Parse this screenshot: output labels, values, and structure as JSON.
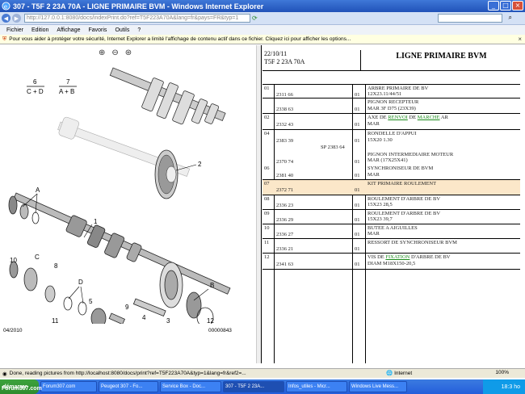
{
  "window": {
    "title": "307 - T5F 2 23A 70A - LIGNE PRIMAIRE BVM - Windows Internet Explorer",
    "address": "http://127.0.0.1:8080/docs/indexPrint.do?ref=T5F223A70A&lang=fr&pays=FR&typ=1",
    "menu": [
      "Fichier",
      "Edition",
      "Affichage",
      "Favoris",
      "Outils",
      "?"
    ],
    "info_bar": "Pour vous aider à protéger votre sécurité, Internet Explorer a limité l'affichage de contenu actif dans ce fichier. Cliquez ici pour afficher les options..."
  },
  "diagram": {
    "bottom_left": "04/2010",
    "bottom_right": "00000843",
    "callouts": {
      "6": "6",
      "cd": "C + D",
      "7": "7",
      "ab": "A + B",
      "A": "A",
      "2": "2",
      "1": "1",
      "C": "C",
      "8": "8",
      "D": "D",
      "5": "5",
      "9": "9",
      "4": "4",
      "3": "3",
      "B": "B",
      "10": "10",
      "11": "11",
      "12": "12"
    }
  },
  "table": {
    "date": "22/10/11",
    "ref": "T5F 2 23A 70A",
    "title": "LIGNE PRIMAIRE BVM",
    "rows": [
      {
        "pos": "01",
        "ref": "2311 66",
        "qty": "01",
        "desc": "ARBRE PRIMAIRE DE BV",
        "desc2": "12X23.11/44/51"
      },
      {
        "pos": "",
        "ref": "2338 63",
        "qty": "01",
        "desc": "PIGNON RECEPTEUR",
        "desc2": "MAR 3F D75 (23X39)"
      },
      {
        "pos": "02",
        "ref": "2332 43",
        "qty": "01",
        "desc_pre": "AXE DE ",
        "desc_link1": "RENVOI",
        "desc_mid": " DE ",
        "desc_link2": "MARCHE",
        "desc_post": " AR",
        "desc2": "MAR"
      },
      {
        "pos": "04",
        "ref": "2383 39",
        "ref2": "SP 2383 64",
        "qty": "01",
        "desc": "RONDELLE D'APPUI",
        "desc2": "15X20 1.30"
      },
      {
        "pos": "",
        "ref": "2370 74",
        "qty": "01",
        "desc": "PIGNON INTERMEDIAIRE MOTEUR",
        "desc2": "MAR (17X25X41)"
      },
      {
        "pos": "06",
        "ref": "2381 40",
        "qty": "01",
        "desc": "SYNCHRONISEUR DE BVM",
        "desc2": "MAR"
      },
      {
        "pos": "07",
        "ref": "2372 71",
        "qty": "01",
        "desc": "KIT PRIMAIRE ROULEMENT",
        "desc2": ""
      },
      {
        "pos": "08",
        "ref": "2336 23",
        "qty": "01",
        "desc": "ROULEMENT D'ARBRE DE BV",
        "desc2": "15X23 28,5"
      },
      {
        "pos": "09",
        "ref": "2336 29",
        "qty": "01",
        "desc": "ROULEMENT D'ARBRE DE BV",
        "desc2": "15X23 39,7"
      },
      {
        "pos": "10",
        "ref": "2336 27",
        "qty": "01",
        "desc": "BUTEE A AIGUILLES",
        "desc2": "MAR"
      },
      {
        "pos": "11",
        "ref": "2336 21",
        "qty": "01",
        "desc": "RESSORT DE SYNCHRONISEUR BVM",
        "desc2": ""
      },
      {
        "pos": "12",
        "ref": "2341 63",
        "qty": "01",
        "desc_pre": "VIS DE ",
        "desc_link1": "FIXATION",
        "desc_post": " D'ARBRE DE BV",
        "desc2": "DIAM M18X150-20,5"
      }
    ]
  },
  "status": {
    "text": "Done, reading pictures from http://localhost:8080/docs/print?ref=T5F223A70A&typ=1&lang=fr&ref2=...",
    "zone": "Internet",
    "zoom": "100%"
  },
  "taskbar": {
    "start": "démarrer",
    "tasks": [
      "Forum307.com",
      "Peugeot 307 - Fo...",
      "Service Box - Doc...",
      "307 - T5F 2 23A...",
      "Infos_utiles - Micr...",
      "Windows Live Mess..."
    ],
    "brand": "Forum307.com",
    "time": "18:3 ho"
  },
  "colors": {
    "highlight_row": "#fbe7c9",
    "link": "#1a8a1a",
    "titlebar": "#2152b8"
  }
}
